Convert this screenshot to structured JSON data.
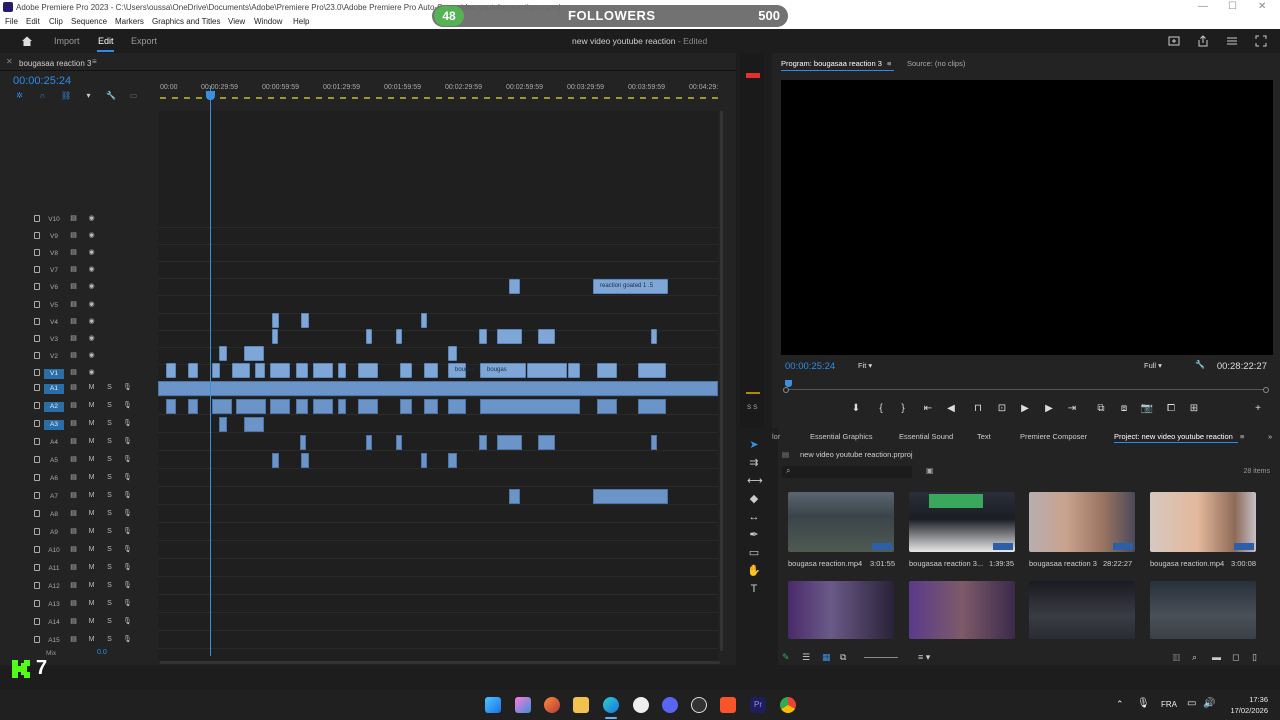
{
  "window": {
    "title": "Adobe Premiere Pro 2023 - C:\\Users\\oussa\\OneDrive\\Documents\\Adobe\\Premiere Pro\\23.0\\Adobe Premiere Pro Auto-S...w video youtube reaction.prproj"
  },
  "followers_widget": {
    "count": "48",
    "label": "FOLLOWERS",
    "target": "500",
    "progress_fraction": 0.096
  },
  "menu": [
    "File",
    "Edit",
    "Clip",
    "Sequence",
    "Markers",
    "Graphics and Titles",
    "View",
    "Window",
    "Help"
  ],
  "header": {
    "tabs": [
      "Import",
      "Edit",
      "Export"
    ],
    "active_tab": "Edit",
    "document": "new video youtube reaction",
    "status": "- Edited"
  },
  "timeline": {
    "sequence_name": "bougasaa reaction 3",
    "timecode": "00:00:25:24",
    "ruler": [
      "00:00",
      "00:00:29:59",
      "00:00:59:59",
      "00:01:29:59",
      "00:01:59:59",
      "00:02:29:59",
      "00:02:59:59",
      "00:03:29:59",
      "00:03:59:59",
      "00:04:29:"
    ],
    "video_tracks": [
      "V10",
      "V9",
      "V8",
      "V7",
      "V6",
      "V5",
      "V4",
      "V3",
      "V2",
      "V1"
    ],
    "audio_tracks": [
      "A1",
      "A2",
      "A3",
      "A4",
      "A5",
      "A6",
      "A7",
      "A8",
      "A9",
      "A10",
      "A11",
      "A12",
      "A13",
      "A14",
      "A15"
    ],
    "mix_label": "Mix",
    "mix_value": "0.0",
    "track_letters": {
      "mute": "M",
      "solo": "S"
    },
    "clip_labels": {
      "v6": "reaction goated 1 .5",
      "v1a": "bougas",
      "v1b": "bougas"
    }
  },
  "mixer_label": "S S",
  "program": {
    "tab_active": "Program: bougasaa reaction 3",
    "tab_source": "Source: (no clips)",
    "timecode": "00:00:25:24",
    "fit": "Fit",
    "resolution": "Full",
    "duration": "00:28:22:27"
  },
  "workspaces": [
    "lor",
    "Essential Graphics",
    "Essential Sound",
    "Text",
    "Premiere Composer",
    "Project: new video youtube reaction"
  ],
  "project": {
    "file": "new video youtube reaction.prproj",
    "item_count": "28 items",
    "items": [
      {
        "name": "bougasa reaction.mp4",
        "duration": "3:01:55"
      },
      {
        "name": "bougasaa reaction 3...",
        "duration": "1:39:35"
      },
      {
        "name": "bougasaa reaction 3",
        "duration": "28:22:27"
      },
      {
        "name": "bougasa reaction.mp4",
        "duration": "3:00:08"
      }
    ]
  },
  "overlay": {
    "badge": "7"
  },
  "taskbar": {
    "language": "FRA",
    "time": "17:36",
    "date": "17/02/2026"
  }
}
